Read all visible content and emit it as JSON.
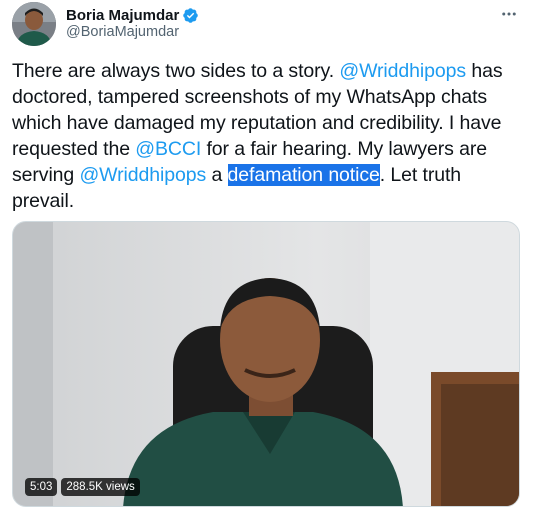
{
  "tweet": {
    "author": {
      "display_name": "Boria Majumdar",
      "handle": "@BoriaMajumdar",
      "verified_icon": "verified-badge-icon",
      "avatar_icon": "profile-avatar"
    },
    "more_icon": "more-horizontal-icon",
    "text": {
      "seg1": "There are always two sides to a story. ",
      "mention1": "@Wriddhipops",
      "seg2": " has doctored, tampered screenshots of my WhatsApp chats which have damaged my reputation and credibility. I have requested the ",
      "mention2": "@BCCI",
      "seg3": " for a fair hearing. My lawyers are serving ",
      "mention3": "@Wriddhipops",
      "seg4": " a ",
      "highlighted": "defamation notice",
      "seg5": ". Let truth prevail."
    },
    "video": {
      "duration": "5:03",
      "views": "288.5K views"
    }
  },
  "colors": {
    "text": "#0f1419",
    "secondary": "#536471",
    "link": "#1d9bf0",
    "selection": "#1a73e8",
    "badge_bg": "rgba(0,0,0,0.77)"
  }
}
